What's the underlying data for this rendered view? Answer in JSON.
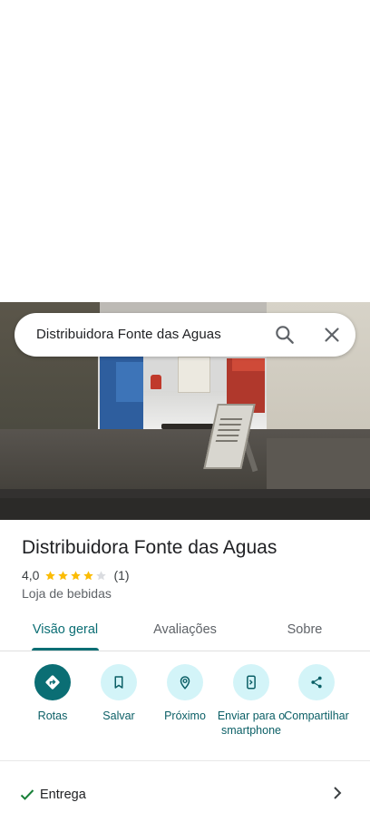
{
  "search": {
    "query": "Distribuidora Fonte das Aguas"
  },
  "place": {
    "name": "Distribuidora Fonte das Aguas",
    "rating": "4,0",
    "stars": 4,
    "reviews": "(1)",
    "category": "Loja de bebidas"
  },
  "tabs": [
    {
      "label": "Visão geral",
      "active": true
    },
    {
      "label": "Avaliações",
      "active": false
    },
    {
      "label": "Sobre",
      "active": false
    }
  ],
  "actions": [
    {
      "label": "Rotas",
      "icon": "directions-icon"
    },
    {
      "label": "Salvar",
      "icon": "bookmark-icon"
    },
    {
      "label": "Próximo",
      "icon": "nearby-icon"
    },
    {
      "label": "Enviar para o smartphone",
      "icon": "send-to-phone-icon"
    },
    {
      "label": "Compartilhar",
      "icon": "share-icon"
    }
  ],
  "services": [
    {
      "label": "Entrega",
      "icon": "check-icon"
    }
  ],
  "colors": {
    "accent": "#0b6e74",
    "accent_light": "#d3f4f8",
    "star": "#fbbc04",
    "check": "#188038"
  }
}
